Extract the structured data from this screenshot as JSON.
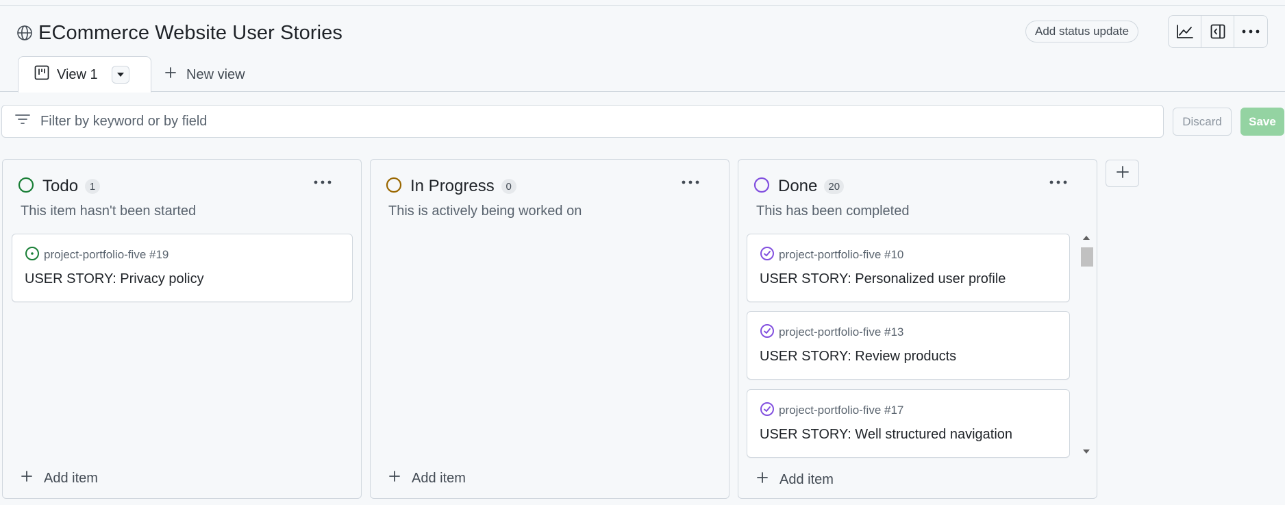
{
  "header": {
    "title": "ECommerce Website User Stories",
    "status_button": "Add status update",
    "icons": [
      "insights-icon",
      "side-panel-icon",
      "more-options-icon"
    ]
  },
  "tabs": {
    "active": {
      "label": "View 1",
      "icon": "board-icon"
    },
    "new_view": "New view"
  },
  "filter": {
    "placeholder": "Filter by keyword or by field",
    "discard": "Discard",
    "save": "Save"
  },
  "colors": {
    "todo": "#1a7f37",
    "in_progress": "#9a6700",
    "done": "#8250df",
    "save_bg": "#94d3a2"
  },
  "columns": [
    {
      "name": "Todo",
      "count": "1",
      "description": "This item hasn't been started",
      "add_item": "Add item",
      "cards": [
        {
          "ref": "project-portfolio-five #19",
          "title": "USER STORY: Privacy policy"
        }
      ]
    },
    {
      "name": "In Progress",
      "count": "0",
      "description": "This is actively being worked on",
      "add_item": "Add item",
      "cards": []
    },
    {
      "name": "Done",
      "count": "20",
      "description": "This has been completed",
      "add_item": "Add item",
      "cards": [
        {
          "ref": "project-portfolio-five #10",
          "title": "USER STORY: Personalized user profile"
        },
        {
          "ref": "project-portfolio-five #13",
          "title": "USER STORY: Review products"
        },
        {
          "ref": "project-portfolio-five #17",
          "title": "USER STORY: Well structured navigation"
        }
      ]
    }
  ]
}
